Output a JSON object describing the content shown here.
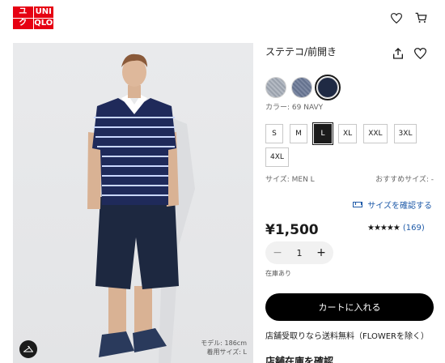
{
  "header": {
    "logo_cells": [
      "ユ",
      "UNI",
      "ク",
      "QLO"
    ],
    "logo_color": "#e60012",
    "icons": [
      "heart-icon",
      "cart-icon"
    ]
  },
  "product": {
    "title": "ステテコ/前開き",
    "color_label": "カラー: 69 NAVY",
    "colors": [
      {
        "name": "light-gray",
        "hex": "#a7adb5"
      },
      {
        "name": "blue-gray",
        "hex": "#6f7c98"
      },
      {
        "name": "navy",
        "hex": "#1f2a44",
        "selected": true
      }
    ],
    "sizes": [
      "S",
      "M",
      "L",
      "XL",
      "XXL",
      "3XL",
      "4XL"
    ],
    "selected_size": "L",
    "size_label": "サイズ: MEN L",
    "recommended_size_label": "おすすめサイズ: -",
    "size_check_link": "サイズを確認する",
    "price": "¥1,500",
    "rating_stars": "★★★★★",
    "rating_count": "(169)",
    "quantity": "1",
    "stock_status": "在庫あり",
    "add_to_cart": "カートに入れる",
    "store_pickup": "店舗受取りなら送料無料（FLOWERを除く）",
    "store_stock_link": "店舗在庫を確認"
  },
  "photo": {
    "model_info_line1": "モデル: 186cm",
    "model_info_line2": "着用サイズ: L"
  }
}
